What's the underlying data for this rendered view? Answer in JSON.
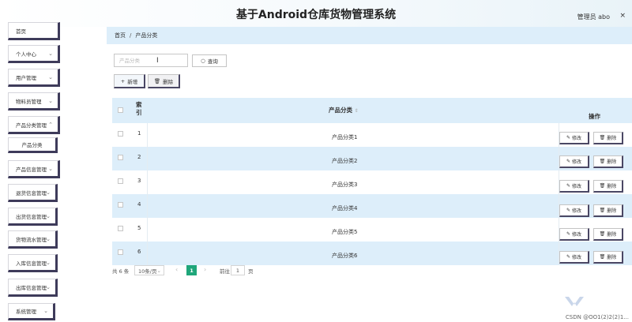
{
  "header": {
    "title": "基于Android仓库货物管理系统",
    "user": "管理员 abo",
    "close": "×"
  },
  "sidebar": {
    "items": [
      {
        "label": "首页"
      },
      {
        "label": "个人中心"
      },
      {
        "label": "用户管理"
      },
      {
        "label": "物料员管理"
      },
      {
        "label": "产品分类管理"
      },
      {
        "label": "产品分类"
      },
      {
        "label": "产品信息管理"
      },
      {
        "label": "退货信息管理"
      },
      {
        "label": "出货信息管理"
      },
      {
        "label": "货物流水管理"
      },
      {
        "label": "入库信息管理"
      },
      {
        "label": "出库信息管理"
      },
      {
        "label": "系统管理"
      }
    ]
  },
  "breadcrumb": {
    "home": "首页",
    "sep": "/",
    "current": "产品分类"
  },
  "search": {
    "placeholder": "产品分类",
    "button": "查询"
  },
  "actions": {
    "add": "新增",
    "delete": "删除"
  },
  "table": {
    "headers": {
      "index": "索\n引",
      "category": "产品分类",
      "sort_icon": "⇕",
      "ops": "操作"
    },
    "rows": [
      {
        "index": "1",
        "category": "产品分类1"
      },
      {
        "index": "2",
        "category": "产品分类2"
      },
      {
        "index": "3",
        "category": "产品分类3"
      },
      {
        "index": "4",
        "category": "产品分类4"
      },
      {
        "index": "5",
        "category": "产品分类5"
      },
      {
        "index": "6",
        "category": "产品分类6"
      }
    ],
    "edit_label": "修改",
    "delete_label": "删除"
  },
  "pagination": {
    "total": "共 6 条",
    "page_size": "10条/页",
    "current_page": "1",
    "goto_label": "前往",
    "goto_value": "1",
    "page_unit": "页"
  },
  "watermark": "CSDN @OO1(2)2(2)1..."
}
